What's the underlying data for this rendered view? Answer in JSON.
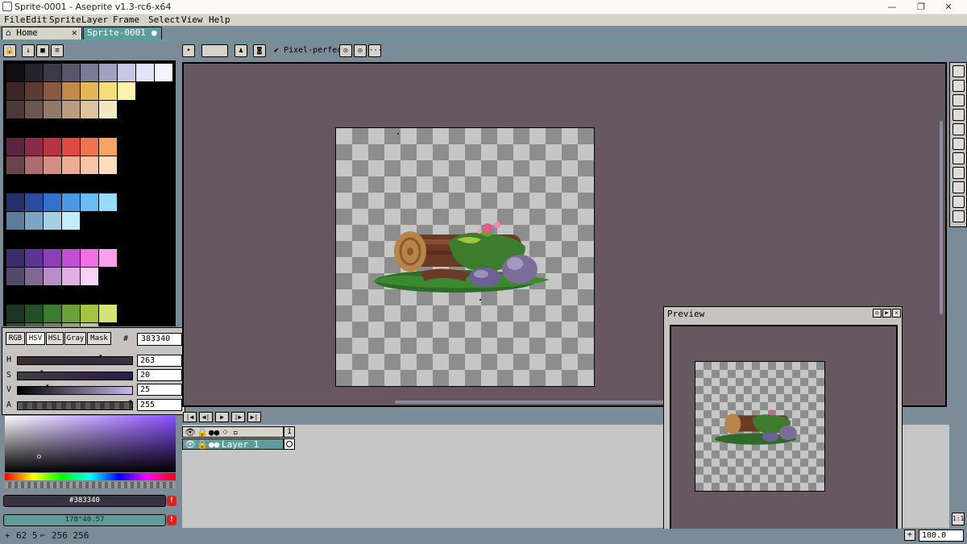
{
  "window": {
    "title": "Sprite-0001 - Aseprite v1.3-rc6-x64",
    "minimize": "—",
    "maximize": "❐",
    "close": "✕"
  },
  "menu": [
    "File",
    "Edit",
    "Sprite",
    "Layer",
    "Frame",
    "Select",
    "View",
    "Help"
  ],
  "tabs": {
    "home": "Home",
    "home_close": "✕",
    "sprite": "Sprite-0001",
    "sprite_dot": "●"
  },
  "toolbar": {
    "pixel_perfect": "Pixel-perfect",
    "pixel_perfect_checked": true,
    "more": "···"
  },
  "palette": {
    "colors": [
      [
        "#0f0f14",
        "#25232b",
        "#3c3a48",
        "#58566a",
        "#7a7a94",
        "#a0a0c0",
        "#c8c8e4",
        "#e4e4f8",
        "#f4f4fc"
      ],
      [
        "#3c2626",
        "#5c3b33",
        "#8a5a40",
        "#c08a4a",
        "#e8b458",
        "#f8dc78",
        "#fcf4a8"
      ],
      [
        "#4a3a3a",
        "#6c5650",
        "#94786a",
        "#bc9c80",
        "#dcc4a0",
        "#f4e8c0"
      ],
      [],
      [
        "#5c2440",
        "#8c2a4c",
        "#b83444",
        "#dc4a40",
        "#f07450",
        "#f8a460"
      ],
      [
        "#6c4450",
        "#ac6c70",
        "#d48c84",
        "#ecac94",
        "#f8c4a4",
        "#fcdcbc"
      ],
      [],
      [
        "#28306c",
        "#2c4ca0",
        "#3470cc",
        "#4c98e4",
        "#6cbcf4",
        "#94dcfc"
      ],
      [
        "#5c7c9c",
        "#7ca4c4",
        "#a4d0e4",
        "#c4ecf8"
      ],
      [],
      [
        "#3c2c6c",
        "#5c3494",
        "#8c40b8",
        "#c050d0",
        "#f070e4",
        "#f8a0ec"
      ],
      [
        "#54486c",
        "#806894",
        "#b88cc4",
        "#e0b0e4",
        "#f8d4f4"
      ],
      [],
      [
        "#1c3424",
        "#245028",
        "#3c7c30",
        "#6ca038",
        "#a4c444",
        "#d4e474"
      ],
      [
        "#38483c",
        "#506450",
        "#6c8460",
        "#94a47c",
        "#bcc89c"
      ]
    ]
  },
  "color_editor": {
    "modes": [
      "RGB",
      "HSV",
      "HSL",
      "Gray",
      "Mask"
    ],
    "active_mode": "HSV",
    "hex_label": "#",
    "hex": "383340",
    "sliders": [
      {
        "label": "H",
        "value": "263",
        "pos": 0.73
      },
      {
        "label": "S",
        "value": "20",
        "pos": 0.2
      },
      {
        "label": "V",
        "value": "25",
        "pos": 0.25
      },
      {
        "label": "A",
        "value": "255",
        "pos": 1.0
      }
    ]
  },
  "fg_color": {
    "label": "#383340",
    "hex": "#383340"
  },
  "bg_color": {
    "label": "178°40.57",
    "hex": "#5c9c9a"
  },
  "warning": "!",
  "timeline": {
    "buttons": [
      "|◀",
      "◀|",
      "▶",
      "|▶",
      "▶|"
    ],
    "frame_number": "1",
    "layer_name": "Layer 1"
  },
  "preview": {
    "title": "Preview"
  },
  "status": {
    "text": "62 5",
    "size": "256 256"
  },
  "zoom": {
    "value": "100.0",
    "zoom_fit": "1:1",
    "plus": "+"
  }
}
